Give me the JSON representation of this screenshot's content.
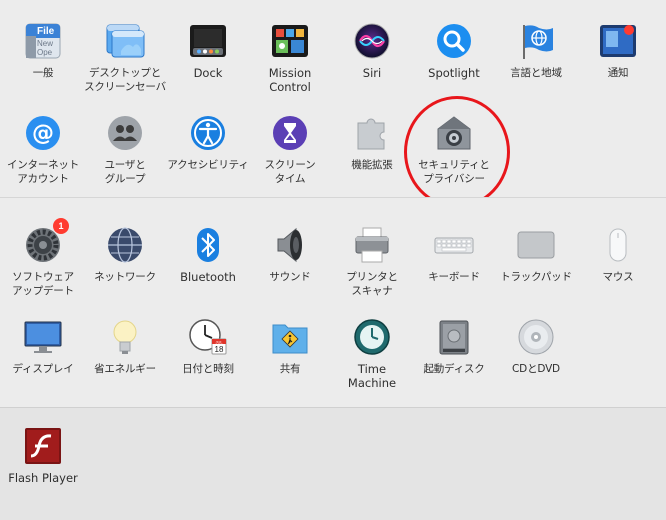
{
  "panes": {
    "general": "一般",
    "desktop": "デスクトップと\nスクリーンセーバ",
    "dock": "Dock",
    "mission_control": "Mission\nControl",
    "siri": "Siri",
    "spotlight": "Spotlight",
    "language": "言語と地域",
    "notifications": "通知",
    "internet_accounts": "インターネット\nアカウント",
    "users": "ユーザと\nグループ",
    "accessibility": "アクセシビリティ",
    "screen_time": "スクリーン\nタイム",
    "extensions": "機能拡張",
    "security": "セキュリティと\nプライバシー",
    "software_update": "ソフトウェア\nアップデート",
    "network": "ネットワーク",
    "bluetooth": "Bluetooth",
    "sound": "サウンド",
    "printers": "プリンタと\nスキャナ",
    "keyboard": "キーボード",
    "trackpad": "トラックパッド",
    "mouse": "マウス",
    "displays": "ディスプレイ",
    "energy": "省エネルギー",
    "datetime": "日付と時刻",
    "sharing": "共有",
    "time_machine": "Time\nMachine",
    "startup_disk": "起動ディスク",
    "cd_dvd": "CDとDVD",
    "flash_player": "Flash Player"
  },
  "icon_text": {
    "general_file": "File",
    "general_new": "New",
    "general_ope": "Ope",
    "calendar_month": "JUL",
    "calendar_day": "18"
  },
  "badges": {
    "software_update": "1"
  },
  "colors": {
    "highlight": "#e8161b",
    "badge": "#ff3b30"
  }
}
